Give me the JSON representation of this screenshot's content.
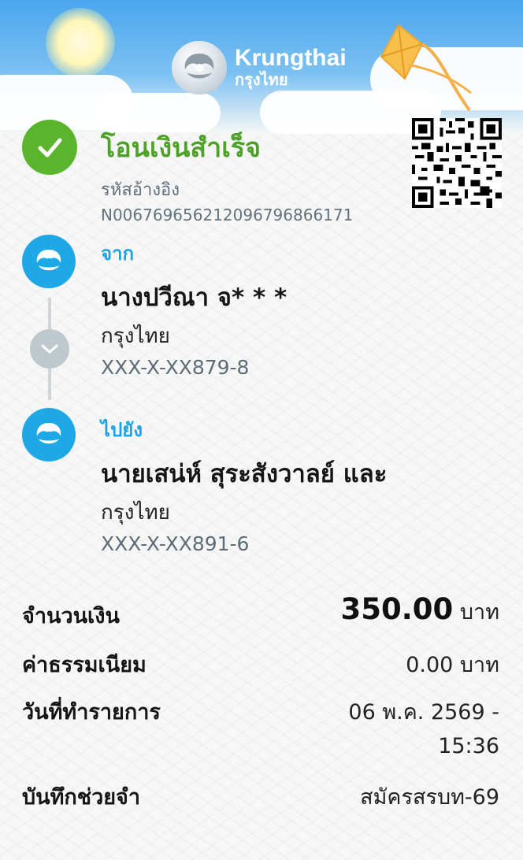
{
  "brand": {
    "name_en": "Krungthai",
    "name_th": "กรุงไทย"
  },
  "status": {
    "title": "โอนเงินสำเร็จ",
    "ref_label": "รหัสอ้างอิง",
    "ref_value": "N006769656212096796866171",
    "color": "#4ea228"
  },
  "from": {
    "label": "จาก",
    "name": "นางปวีณา จ* * *",
    "bank": "กรุงไทย",
    "account": "XXX-X-XX879-8"
  },
  "to": {
    "label": "ไปยัง",
    "name": "นายเสน่ห์ สุระสังวาลย์ และ",
    "bank": "กรุงไทย",
    "account": "XXX-X-XX891-6"
  },
  "details": {
    "amount_label": "จำนวนเงิน",
    "amount_value": "350.00",
    "amount_unit": "บาท",
    "fee_label": "ค่าธรรมเนียม",
    "fee_value": "0.00 บาท",
    "date_label": "วันที่ทำรายการ",
    "date_line1": "06 พ.ค. 2569 -",
    "date_line2": "15:36",
    "memo_label": "บันทึกช่วยจำ",
    "memo_value": "สมัครสรบท-69"
  },
  "icons": {
    "success": "check-circle-icon",
    "bank": "krungthai-logo-icon",
    "connector": "chevron-down-icon",
    "qr": "qr-code-icon"
  },
  "colors": {
    "accent_blue": "#1aa3e4",
    "success_green": "#5bb52c"
  }
}
